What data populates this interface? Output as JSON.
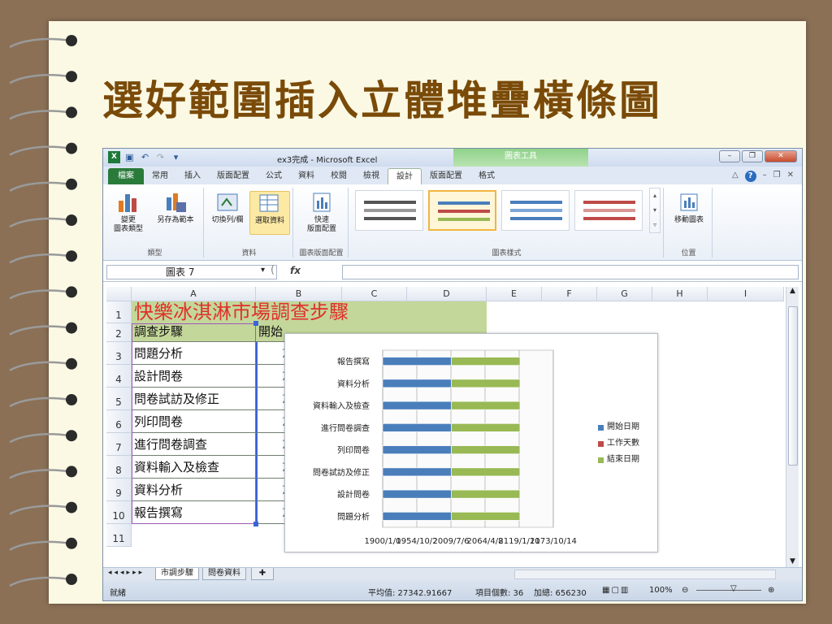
{
  "slide": {
    "title": "選好範圍插入立體堆疊橫條圖"
  },
  "excel": {
    "window_title": "ex3完成 - Microsoft Excel",
    "context_tab": "圖表工具",
    "tabs": [
      "檔案",
      "常用",
      "插入",
      "版面配置",
      "公式",
      "資料",
      "校閱",
      "檢視",
      "設計",
      "版面配置",
      "格式"
    ],
    "active_tab": "設計",
    "ribbon": {
      "change_type": "變更\n圖表類型",
      "save_template": "另存為範本",
      "group_type": "類型",
      "switch_row_col": "切換列/欄",
      "select_data": "選取資料",
      "group_data": "資料",
      "quick_layout": "快速\n版面配置",
      "group_layout": "圖表版面配置",
      "group_styles": "圖表樣式",
      "move_chart": "移動圖表",
      "group_location": "位置"
    },
    "name_box": "圖表 7",
    "fx": "fx",
    "columns": [
      "A",
      "B",
      "C",
      "D",
      "E",
      "F",
      "G",
      "H",
      "I"
    ],
    "rows": [
      "1",
      "2",
      "3",
      "4",
      "5",
      "6",
      "7",
      "8",
      "9",
      "10",
      "11"
    ],
    "a1": "快樂冰淇淋市場調查步驟",
    "a2": "調查步驟",
    "b2": "開始",
    "steps": [
      "問題分析",
      "設計問卷",
      "問卷試訪及修正",
      "列印問卷",
      "進行問卷調查",
      "資料輸入及檢查",
      "資料分析",
      "報告撰寫"
    ],
    "sheet_tabs": [
      "市調步驟",
      "問卷資料"
    ],
    "status": {
      "ready": "就緒",
      "average": "平均值: 27342.91667",
      "count": "項目個數: 36",
      "sum": "加總: 656230",
      "zoom": "100%"
    }
  },
  "chart_data": {
    "type": "bar",
    "stacked": true,
    "categories": [
      "問題分析",
      "設計問卷",
      "問卷試訪及修正",
      "列印問卷",
      "進行問卷調查",
      "資料輸入及檢查",
      "資料分析",
      "報告撰寫"
    ],
    "series": [
      {
        "name": "開始日期",
        "color": "#4a7ebb",
        "values": [
          40200,
          40205,
          40210,
          40215,
          40220,
          40225,
          40230,
          40235
        ]
      },
      {
        "name": "工作天數",
        "color": "#be4b48",
        "values": [
          5,
          5,
          5,
          5,
          5,
          5,
          5,
          5
        ]
      },
      {
        "name": "結束日期",
        "color": "#98b954",
        "values": [
          40205,
          40210,
          40215,
          40220,
          40225,
          40230,
          40235,
          40240
        ]
      }
    ],
    "x_tick_labels": [
      "1900/1/0",
      "1954/10/2",
      "2009/7/6",
      "2064/4/8",
      "2119/1/10",
      "2173/10/14"
    ],
    "xlim": [
      0,
      100000
    ],
    "legend_position": "right"
  }
}
